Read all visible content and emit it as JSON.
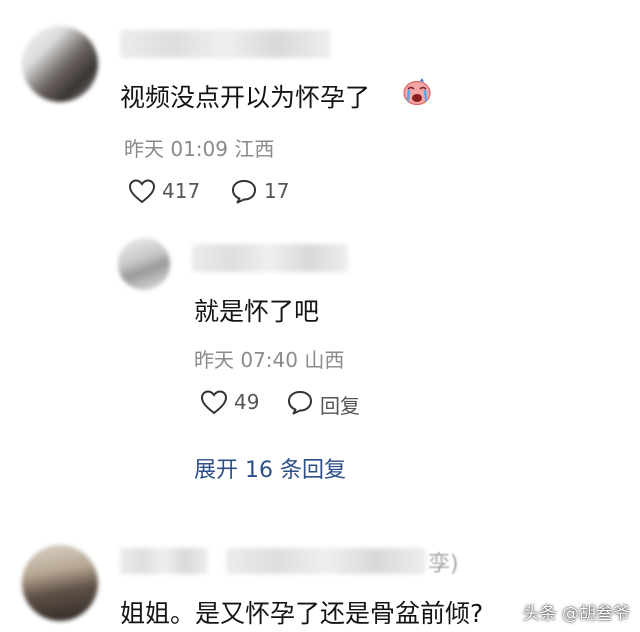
{
  "comment1": {
    "text": "视频没点开以为怀孕了",
    "emoji_icon": "crying-face-emoji-icon",
    "date": "昨天 01:09",
    "location": "江西",
    "likes": "417",
    "replies": "17"
  },
  "reply1": {
    "text": "就是怀了吧",
    "date": "昨天 07:40",
    "location": "山西",
    "likes": "49",
    "reply_label": "回复"
  },
  "expand_label": "展开 16 条回复",
  "comment2": {
    "name_tail": "孪)",
    "text": "姐姐。是又怀孕了还是骨盆前倾?"
  },
  "watermark": "头条 @胡叁爷",
  "colors": {
    "link": "#2e4f8a",
    "meta": "#8a8a8a",
    "text": "#141414"
  }
}
